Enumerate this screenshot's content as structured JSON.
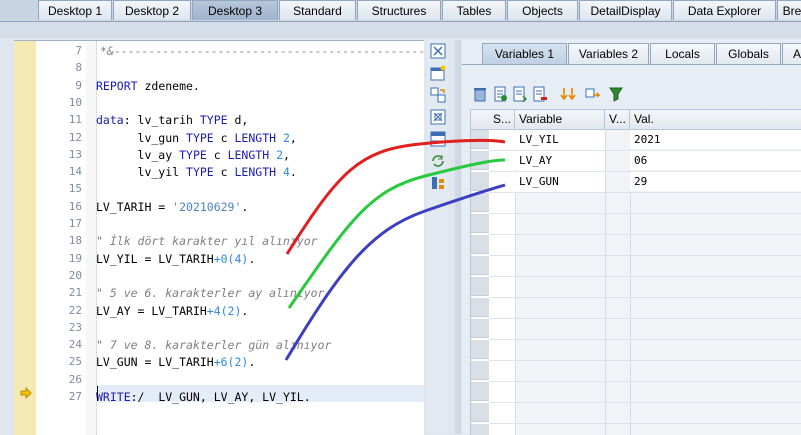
{
  "top_tabs": [
    "Desktop 1",
    "Desktop 2",
    "Desktop 3",
    "Standard",
    "Structures",
    "Tables",
    "Objects",
    "DetailDisplay",
    "Data Explorer",
    "Bre"
  ],
  "active_top_tab": "Desktop 3",
  "editor": {
    "lines": [
      {
        "no": "7",
        "html": "<span class=\"cmt\">*&amp;---------------------------------------------------------</span>"
      },
      {
        "no": "8",
        "html": ""
      },
      {
        "no": "9",
        "html": "<span class=\"kw\">REPORT</span> zdeneme."
      },
      {
        "no": "10",
        "html": ""
      },
      {
        "no": "11",
        "html": "<span class=\"kw\">data</span>: lv_tarih <span class=\"kw\">TYPE</span> d,"
      },
      {
        "no": "12",
        "html": "      lv_gun <span class=\"kw\">TYPE</span> c <span class=\"kw\">LENGTH</span> <span class=\"num\">2</span>,"
      },
      {
        "no": "13",
        "html": "      lv_ay <span class=\"kw\">TYPE</span> c <span class=\"kw\">LENGTH</span> <span class=\"num\">2</span>,"
      },
      {
        "no": "14",
        "html": "      lv_yil <span class=\"kw\">TYPE</span> c <span class=\"kw\">LENGTH</span> <span class=\"num\">4</span>."
      },
      {
        "no": "15",
        "html": ""
      },
      {
        "no": "16",
        "html": "LV_TARIH = <span class=\"str\">'20210629'</span>."
      },
      {
        "no": "17",
        "html": ""
      },
      {
        "no": "18",
        "html": "<span class=\"cmt\">\" İlk dört karakter yıl alınıyor</span>"
      },
      {
        "no": "19",
        "html": "LV_YIL = LV_TARIH<span class=\"num\">+0(4)</span>."
      },
      {
        "no": "20",
        "html": ""
      },
      {
        "no": "21",
        "html": "<span class=\"cmt\">\" 5 ve 6. karakterler ay alınıyor</span>"
      },
      {
        "no": "22",
        "html": "LV_AY = LV_TARIH<span class=\"num\">+4(2)</span>."
      },
      {
        "no": "23",
        "html": ""
      },
      {
        "no": "24",
        "html": "<span class=\"cmt\">\" 7 ve 8. karakterler gün alınıyor</span>"
      },
      {
        "no": "25",
        "html": "LV_GUN = LV_TARIH<span class=\"num\">+6(2)</span>."
      },
      {
        "no": "26",
        "html": ""
      },
      {
        "no": "27",
        "html": "<span class=\"kw\">WRITE</span>:/  LV_GUN, LV_AY, LV_YIL."
      }
    ]
  },
  "debugger_tabs": [
    "Variables 1",
    "Variables 2",
    "Locals",
    "Globals",
    "A"
  ],
  "active_debugger_tab": "Variables 1",
  "grid": {
    "columns": [
      "S...",
      "Variable",
      "V...",
      "Val."
    ],
    "rows": [
      {
        "variable": "LV_YIL",
        "value": "2021"
      },
      {
        "variable": "LV_AY",
        "value": "06"
      },
      {
        "variable": "LV_GUN",
        "value": "29"
      }
    ]
  },
  "colors": {
    "arrow_yil": "#e01f1f",
    "arrow_ay": "#27c93f",
    "arrow_gun": "#3b3fc0"
  }
}
